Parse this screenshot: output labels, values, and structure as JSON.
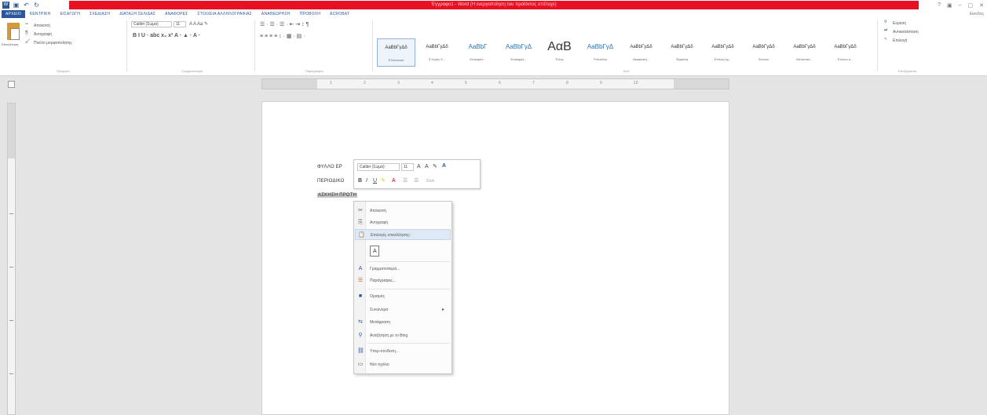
{
  "window": {
    "title": "Έγγραφο1 - Word (Η ενεργοποίηση του προϊόντος απέτυχε)",
    "controls": [
      "?",
      "▣",
      "–",
      "▢",
      "✕"
    ]
  },
  "ribbon_tabs": {
    "file": "ΑΡΧΕΙΟ",
    "items": [
      "ΚΕΝΤΡΙΚΗ",
      "ΕΙΣΑΓΩΓΗ",
      "ΣΧΕΔΙΑΣΗ",
      "ΔΙΑΤΑΞΗ ΣΕΛΙΔΑΣ",
      "ΑΝΑΦΟΡΕΣ",
      "ΣΤΟΙΧΕΙΑ ΑΛΛΗΛΟΓΡΑΦΙΑΣ",
      "ΑΝΑΘΕΩΡΗΣΗ",
      "ΠΡΟΒΟΛΗ",
      "ACROBAT"
    ],
    "sign_in": "Είσοδος"
  },
  "clipboard": {
    "paste": "Επικόλληση",
    "cut": "Αποκοπή",
    "copy": "Αντιγραφή",
    "format_painter": "Πινέλο μορφοποίησης",
    "label": "Πρόχειρο"
  },
  "font": {
    "name": "Calibri (Σώμα)",
    "size": "11",
    "label": "Γραμματοσειρά"
  },
  "paragraph": {
    "label": "Παράγραφος"
  },
  "styles": {
    "label": "Στυλ",
    "items": [
      {
        "sample": "AaBbΓγΔδ",
        "name": "¶ Κανονικό",
        "selected": true
      },
      {
        "sample": "AaBbΓγΔδ",
        "name": "¶ Χωρίς δ..."
      },
      {
        "sample": "AaBbΓ",
        "name": "Επικεφαλ..."
      },
      {
        "sample": "AaBbΓγΔ",
        "name": "Επικεφαλ..."
      },
      {
        "sample": "ΑαΒ",
        "name": "Τίτλος"
      },
      {
        "sample": "AaBbΓγΔ",
        "name": "Υπότιτλος"
      },
      {
        "sample": "AaBbΓγΔδ",
        "name": "Διακριτική..."
      },
      {
        "sample": "AaBbΓγΔδ",
        "name": "Έμφαση"
      },
      {
        "sample": "AaBbΓγΔδ",
        "name": "Έντονη έμ..."
      },
      {
        "sample": "AaBbΓγΔδ",
        "name": "Έντονο"
      },
      {
        "sample": "AaBbΓγΔδ",
        "name": "Απόσπασ..."
      },
      {
        "sample": "AaBbΓγΔδ",
        "name": "Έντονο α..."
      }
    ]
  },
  "editing": {
    "find": "Εύρεση",
    "replace": "Αντικατάσταση",
    "select": "Επιλογή",
    "label": "Επεξεργασία"
  },
  "ruler_numbers": [
    "1",
    "2",
    "3",
    "4",
    "5",
    "6",
    "7",
    "8",
    "9",
    "10"
  ],
  "document": {
    "lines": [
      "ΦΥΛΛΟ ΕΡ",
      "ΠΕΡΙΟΔΙΚΟ",
      "ΑΣΚΗΣΗ ΠΡΩΤΗ"
    ]
  },
  "mini_toolbar": {
    "font": "Calibri (Σώμα)",
    "size": "11",
    "styles": "Στυλ"
  },
  "context_menu": {
    "items": [
      {
        "label": "Αποκοπή",
        "icon": "scissors-icon"
      },
      {
        "label": "Αντιγραφή",
        "icon": "copy-icon"
      },
      {
        "label": "Επιλογές επικόλλησης:",
        "icon": "paste-icon",
        "hover": true
      },
      {
        "label": "Γραμματοσειρά...",
        "icon": "font-icon"
      },
      {
        "label": "Παράγραφος...",
        "icon": "paragraph-icon"
      },
      {
        "label": "Ορισμός",
        "icon": "book-icon"
      },
      {
        "label": "Συνώνυμα",
        "icon": "",
        "submenu": true
      },
      {
        "label": "Μετάφραση",
        "icon": "translate-icon"
      },
      {
        "label": "Αναζήτηση με το Bing",
        "icon": "search-icon"
      },
      {
        "label": "Υπερ-σύνδεση...",
        "icon": "link-icon"
      },
      {
        "label": "Νέο σχόλιο",
        "icon": "comment-icon"
      }
    ]
  }
}
